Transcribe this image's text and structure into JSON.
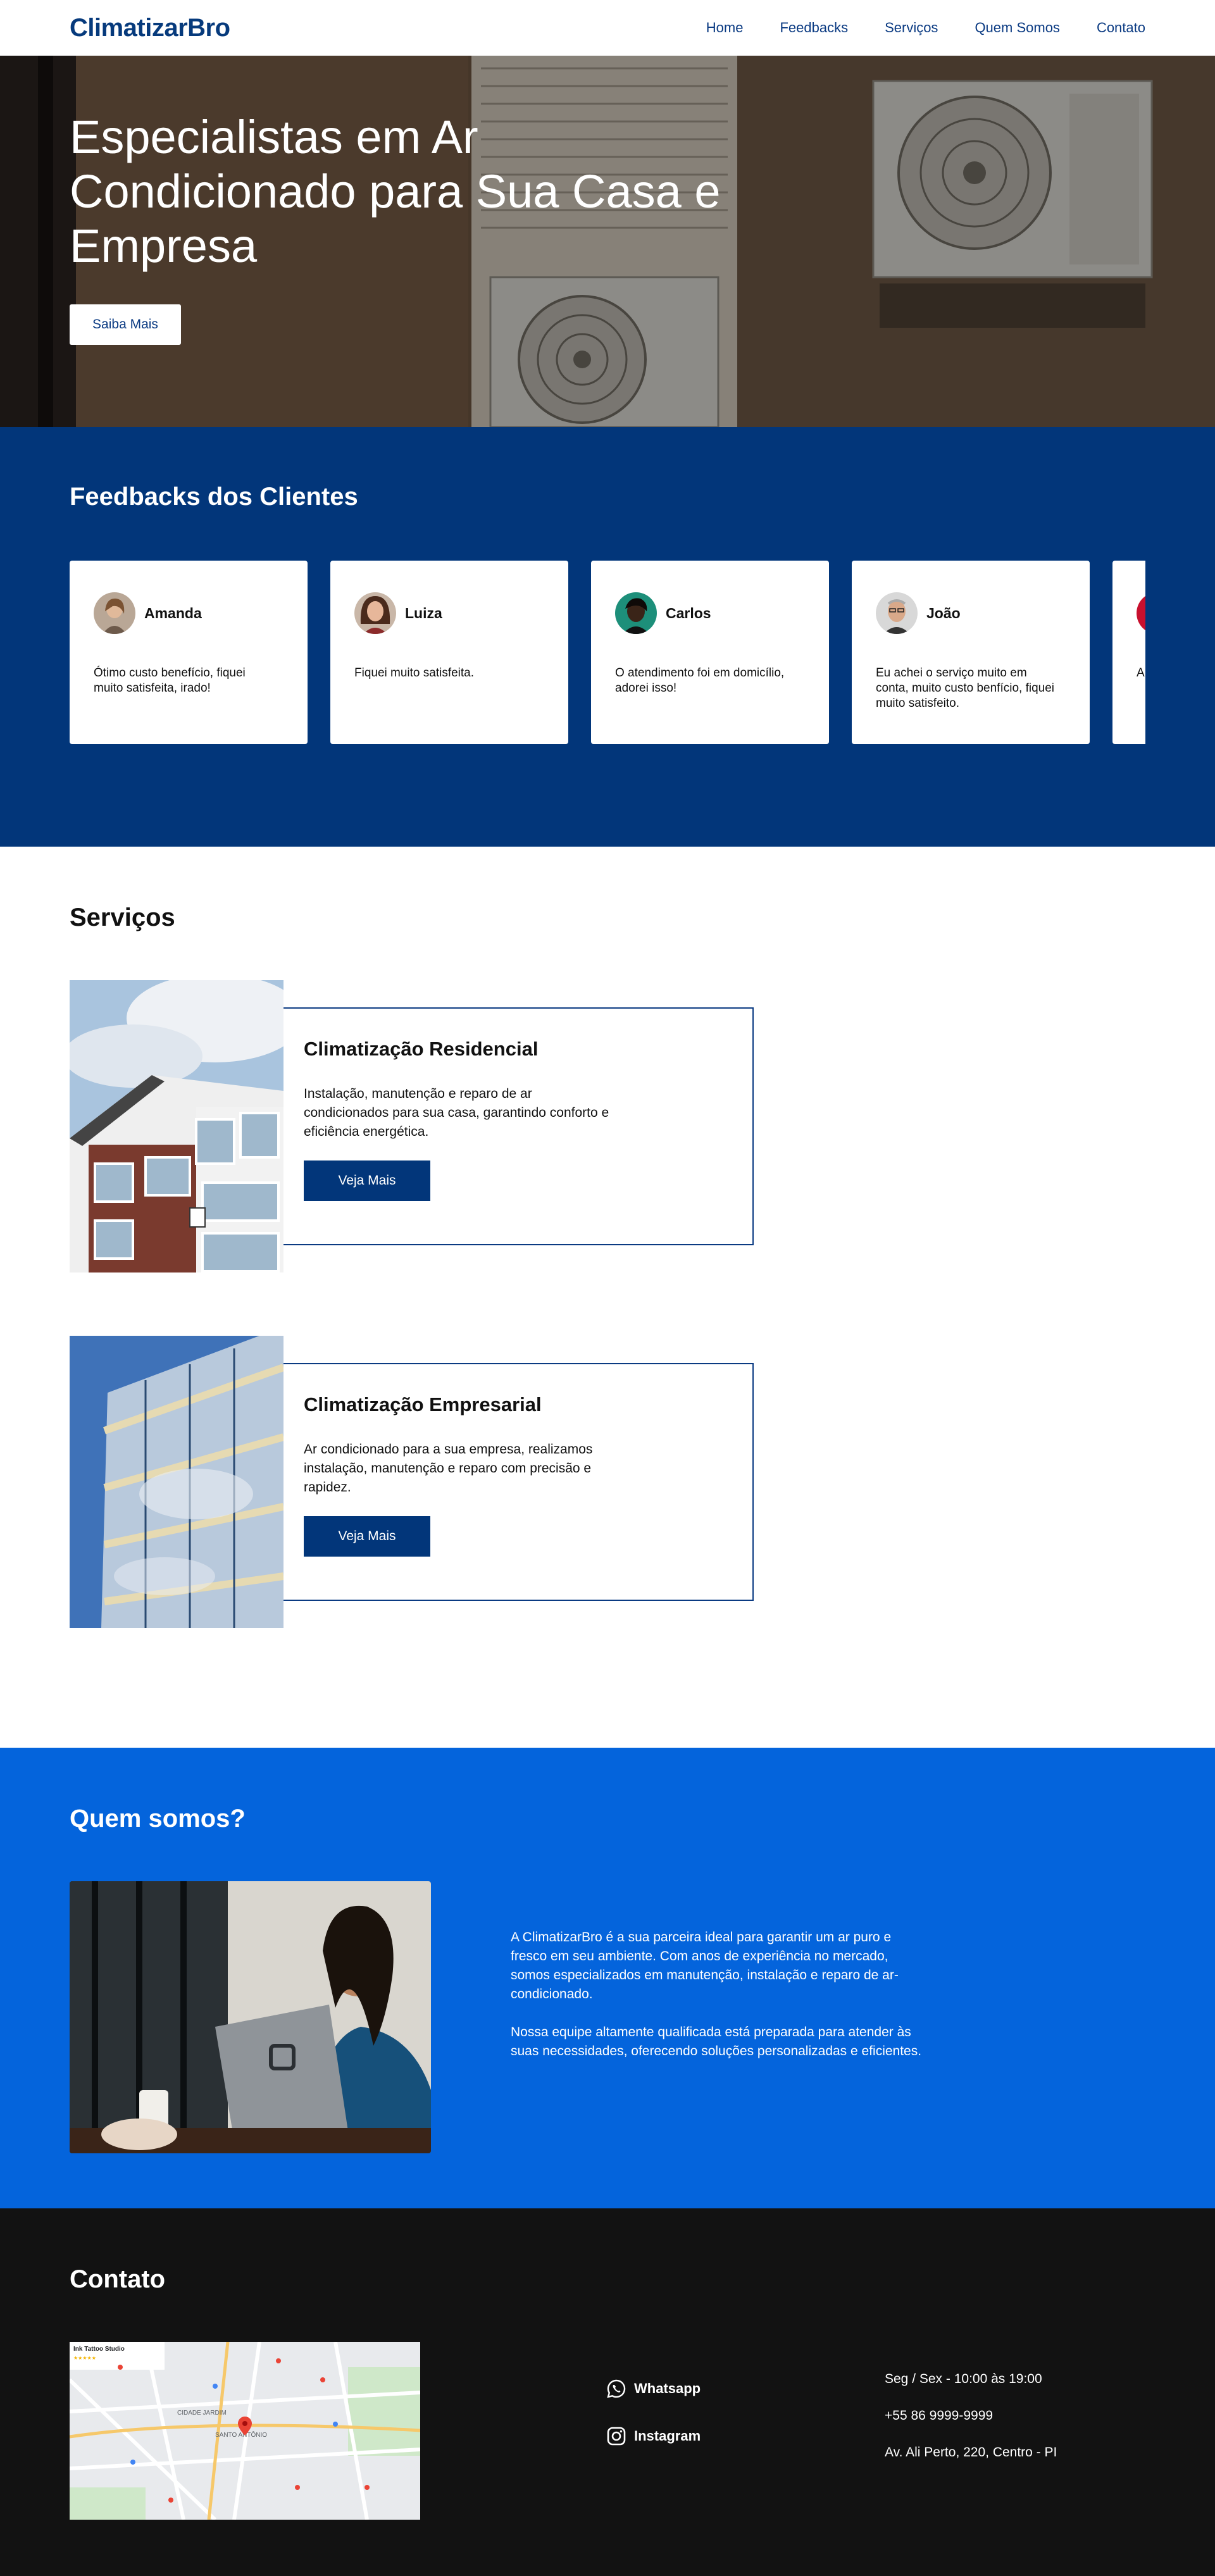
{
  "header": {
    "logo": "ClimatizarBro",
    "nav": [
      "Home",
      "Feedbacks",
      "Serviços",
      "Quem Somos",
      "Contato"
    ]
  },
  "hero": {
    "title": "Especialistas em Ar Condicionado para Sua Casa e Empresa",
    "button": "Saiba Mais"
  },
  "feedbacks": {
    "title": "Feedbacks dos Clientes",
    "items": [
      {
        "name": "Amanda",
        "text": "Ótimo custo benefício, fiquei muito satisfeita, irado!"
      },
      {
        "name": "Luiza",
        "text": "Fiquei muito satisfeita."
      },
      {
        "name": "Carlos",
        "text": "O atendimento foi em domicílio, adorei isso!"
      },
      {
        "name": "João",
        "text": "Eu achei o serviço muito em conta, muito custo benfício, fiquei muito satisfeito."
      },
      {
        "name": "",
        "text": "A"
      }
    ]
  },
  "services": {
    "title": "Serviços",
    "items": [
      {
        "title": "Climatização Residencial",
        "text": "Instalação, manutenção e reparo de ar condicionados para sua casa, garantindo conforto e eficiência energética.",
        "button": "Veja Mais"
      },
      {
        "title": "Climatização Empresarial",
        "text": "Ar condicionado para a sua empresa, realizamos instalação, manutenção e reparo com precisão e rapidez.",
        "button": "Veja Mais"
      }
    ]
  },
  "about": {
    "title": "Quem somos?",
    "paragraphs": [
      "A ClimatizarBro é a sua parceira ideal para garantir um ar puro e fresco em seu ambiente. Com anos de experiência no mercado, somos especializados em manutenção, instalação e reparo de ar-condicionado.",
      "Nossa equipe altamente qualificada está preparada para atender às suas necessidades, oferecendo soluções personalizadas e eficientes."
    ]
  },
  "contact": {
    "title": "Contato",
    "social": [
      "Whatsapp",
      "Instagram"
    ],
    "hours": "Seg / Sex - 10:00 às 19:00",
    "phone": "+55 86 9999-9999",
    "address": "Av. Ali Perto, 220, Centro - PI",
    "map_labels": [
      "Ink Tattoo Studio",
      "SANTO ANTÔNIO",
      "CIDADE JARDIM"
    ]
  },
  "colors": {
    "brand_dark": "#02367a",
    "brand_blue": "#0464dc",
    "footer": "#121212"
  },
  "icons": [
    "whatsapp-icon",
    "instagram-icon",
    "map-pin-icon"
  ]
}
